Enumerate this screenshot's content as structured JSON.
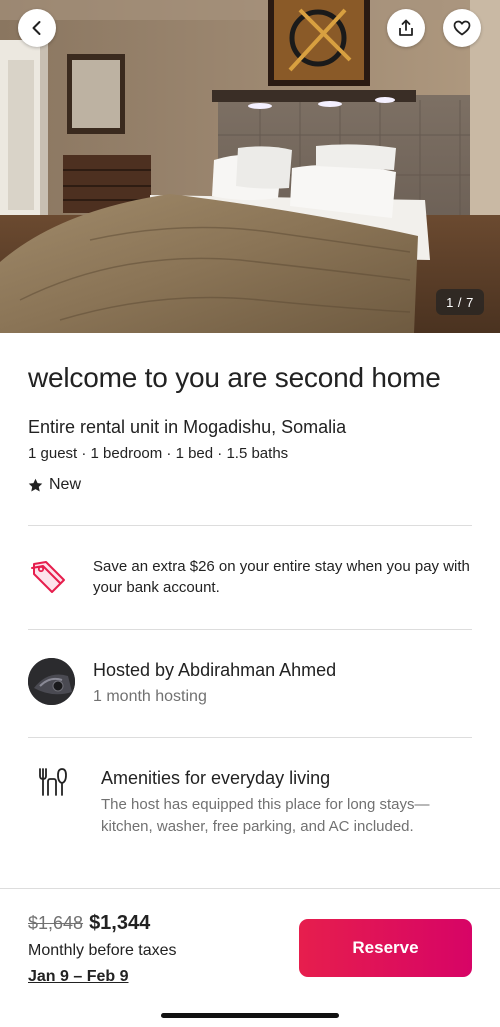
{
  "hero": {
    "photo_counter": "1 / 7",
    "back_icon": "chevron-left-icon",
    "share_icon": "share-icon",
    "save_icon": "heart-icon"
  },
  "listing": {
    "title": "welcome to you are second home",
    "subtitle": "Entire rental unit in Mogadishu, Somalia",
    "details": "1 guest · 1 bedroom · 1 bed · 1.5 baths",
    "badge": "New"
  },
  "promo": {
    "icon": "price-tag-icon",
    "text": "Save an extra $26 on your entire stay when you pay with your bank account."
  },
  "host": {
    "name": "Hosted by Abdirahman Ahmed",
    "since": "1 month hosting"
  },
  "amenity": {
    "icon": "utensils-icon",
    "title": "Amenities for everyday living",
    "description": "The host has equipped this place for long stays—kitchen, washer, free parking, and AC included."
  },
  "footer": {
    "price_original": "$1,648",
    "price_current": "$1,344",
    "price_note": "Monthly before taxes",
    "dates": "Jan 9 – Feb 9",
    "reserve_label": "Reserve"
  },
  "colors": {
    "accent": "#e61e4d",
    "text_primary": "#222222",
    "text_secondary": "#717171",
    "divider": "#dddddd"
  }
}
